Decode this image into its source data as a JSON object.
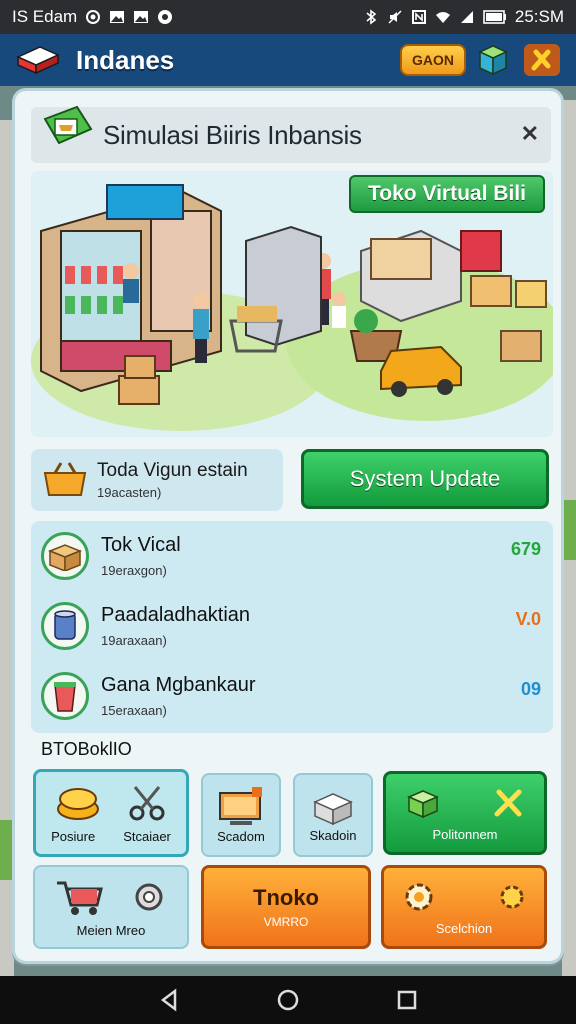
{
  "status_bar": {
    "left_text": "IS Edam",
    "time": "25:SM"
  },
  "app_bar": {
    "title": "Indanes",
    "gaon_button": "GAON"
  },
  "dialog": {
    "title": "Simulasi Biiris Inbansis",
    "close": "✕"
  },
  "hero": {
    "tag": "Toko Virtual Bili"
  },
  "info_card": {
    "title": "Toda Vigun estain",
    "subtitle": "19acasten)"
  },
  "system_update": {
    "label": "System Update"
  },
  "list": [
    {
      "title": "Tok Vical",
      "subtitle": "19eraxgon)",
      "value": "679",
      "value_color": "#22a83a"
    },
    {
      "title": "Paadaladhaktian",
      "subtitle": "19araxaan)",
      "value": "V.0",
      "value_color": "#e8701a"
    },
    {
      "title": "Gana Mgbankaur",
      "subtitle": "15eraxaan)",
      "value": "09",
      "value_color": "#1f8fd1"
    }
  ],
  "section_title": "BTOBoklIO",
  "grid": {
    "posiure": "Posiure",
    "stcaiaer": "Stcaiaer",
    "scadom": "Scadom",
    "skadoin": "Skadoin",
    "politonnem": "Politonnem",
    "meien_mreo": "Meien Mreo",
    "tnoko": "Tnoko",
    "tnoko_sub": "VMRRO",
    "scelchion": "Scelchion"
  },
  "colors": {
    "app_bar": "#17497d",
    "green": "#1f9a40",
    "orange": "#f0731a"
  }
}
